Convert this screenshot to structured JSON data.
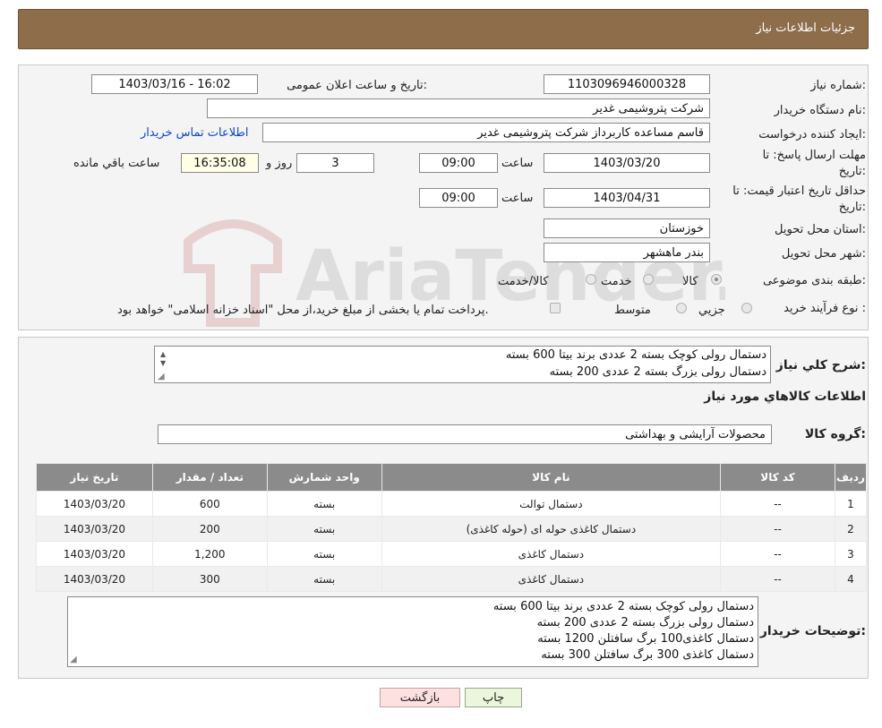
{
  "header": {
    "title": "جزئیات اطلاعات نیاز"
  },
  "form": {
    "need_number_label": "شماره نیاز:",
    "need_number": "1103096946000328",
    "announce_label": "تاریخ و ساعت اعلان عمومی:",
    "announce_value": "1403/03/16 - 16:02",
    "buyer_label": "نام دستگاه خریدار:",
    "buyer_value": "شرکت پتروشیمی غدیر",
    "creator_label": "ایجاد کننده درخواست:",
    "creator_value": "قاسم مساعده کاربرداز شرکت پتروشیمی غدیر",
    "contact_link": "اطلاعات تماس خریدار",
    "deadline_label_1": "مهلت ارسال پاسخ: تا",
    "deadline_label_2": "تاریخ:",
    "deadline_date": "1403/03/20",
    "time_label": "ساعت",
    "deadline_time": "09:00",
    "days_value": "3",
    "days_label": "روز و",
    "remaining_time": "16:35:08",
    "remaining_label": "ساعت باقي مانده",
    "validity_label_1": "حداقل تاریخ اعتبار قیمت: تا",
    "validity_label_2": "تاریخ:",
    "validity_date": "1403/04/31",
    "validity_time": "09:00",
    "province_label": "استان محل تحویل:",
    "province_value": "خوزستان",
    "city_label": "شهر محل تحویل:",
    "city_value": "بندر ماهشهر",
    "category_label": "طبقه بندی موضوعی:",
    "category_options": [
      "کالا",
      "خدمت",
      "کالا/خدمت"
    ],
    "process_label": "نوع فرآیند خرید :",
    "process_options": [
      "جزیي",
      "متوسط"
    ],
    "process_note": "پرداخت تمام یا بخشی از مبلغ خرید،از محل \"اسناد خزانه اسلامی\" خواهد بود."
  },
  "summary": {
    "label": "شرح کلي نياز:",
    "lines": [
      "دستمال رولی کوچک بسته 2 عددی برند بیتا 600 بسته",
      "دستمال رولی بزرگ بسته 2 عددی 200 بسته"
    ],
    "items_heading": "اطلاعات کالاهاي مورد نياز",
    "group_label": "گروه کالا:",
    "group_value": "محصولات آرایشی و بهداشتی"
  },
  "table": {
    "headers": [
      "ردیف",
      "کد کالا",
      "نام کالا",
      "واحد شمارش",
      "تعداد / مقدار",
      "تاریخ نیاز"
    ],
    "rows": [
      [
        "1",
        "--",
        "دستمال توالت",
        "بسته",
        "600",
        "1403/03/20"
      ],
      [
        "2",
        "--",
        "دستمال کاغذی حوله ای (حوله کاغذی)",
        "بسته",
        "200",
        "1403/03/20"
      ],
      [
        "3",
        "--",
        "دستمال کاغذی",
        "بسته",
        "1,200",
        "1403/03/20"
      ],
      [
        "4",
        "--",
        "دستمال کاغذی",
        "بسته",
        "300",
        "1403/03/20"
      ]
    ]
  },
  "notes": {
    "label": "توضیحات خریدار:",
    "lines": [
      "دستمال رولی کوچک بسته 2 عددی برند بیتا 600 بسته",
      "دستمال رولی بزرگ بسته 2 عددی 200 بسته",
      "دستمال کاغذی100 برگ سافتلن 1200 بسته",
      "دستمال کاغذی 300 برگ سافتلن 300 بسته"
    ]
  },
  "buttons": {
    "print": "چاپ",
    "back": "بازگشت"
  },
  "watermark": {
    "text": "AriaTender.neT"
  },
  "colors": {
    "header_bg": "#8d6d4a",
    "table_header_bg": "#8b8b8b",
    "print_bg": "#eaf7dc",
    "back_bg": "#fde0e0",
    "link": "#0b45d6"
  }
}
